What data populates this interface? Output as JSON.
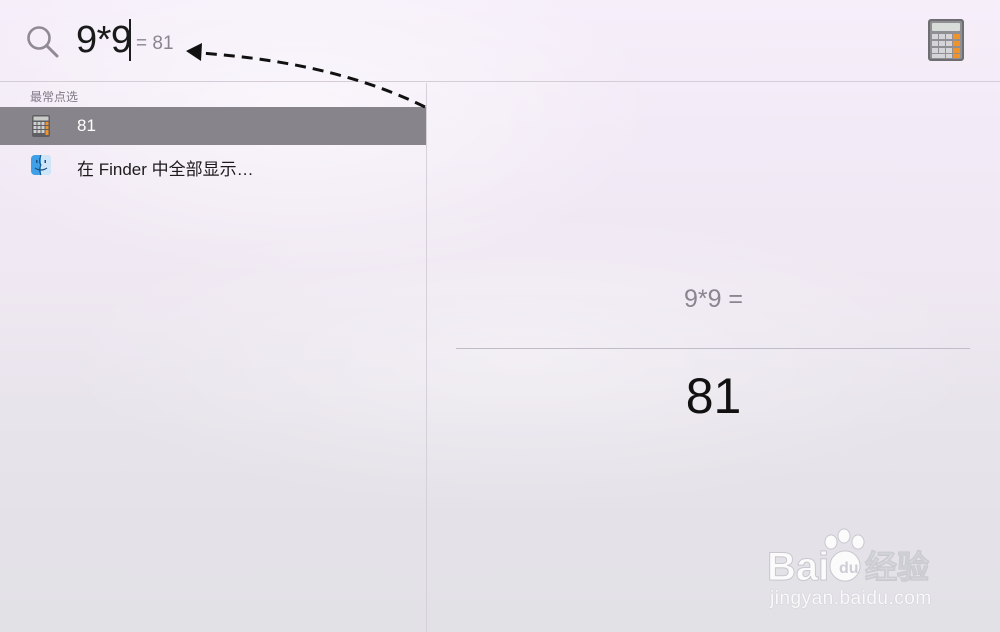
{
  "search": {
    "query": "9*9",
    "inline_result": "= 81"
  },
  "results": {
    "section_header": "最常点选",
    "items": [
      {
        "label": "81",
        "icon": "calculator-icon",
        "selected": true
      },
      {
        "label": "在 Finder 中全部显示…",
        "icon": "finder-icon",
        "selected": false
      }
    ]
  },
  "preview": {
    "expression": "9*9 =",
    "result": "81"
  },
  "watermark": {
    "logo_text": "Bai 经验",
    "url": "jingyan.baidu.com"
  },
  "colors": {
    "selection": "#87858b",
    "calculator_orange": "#f0932b"
  }
}
